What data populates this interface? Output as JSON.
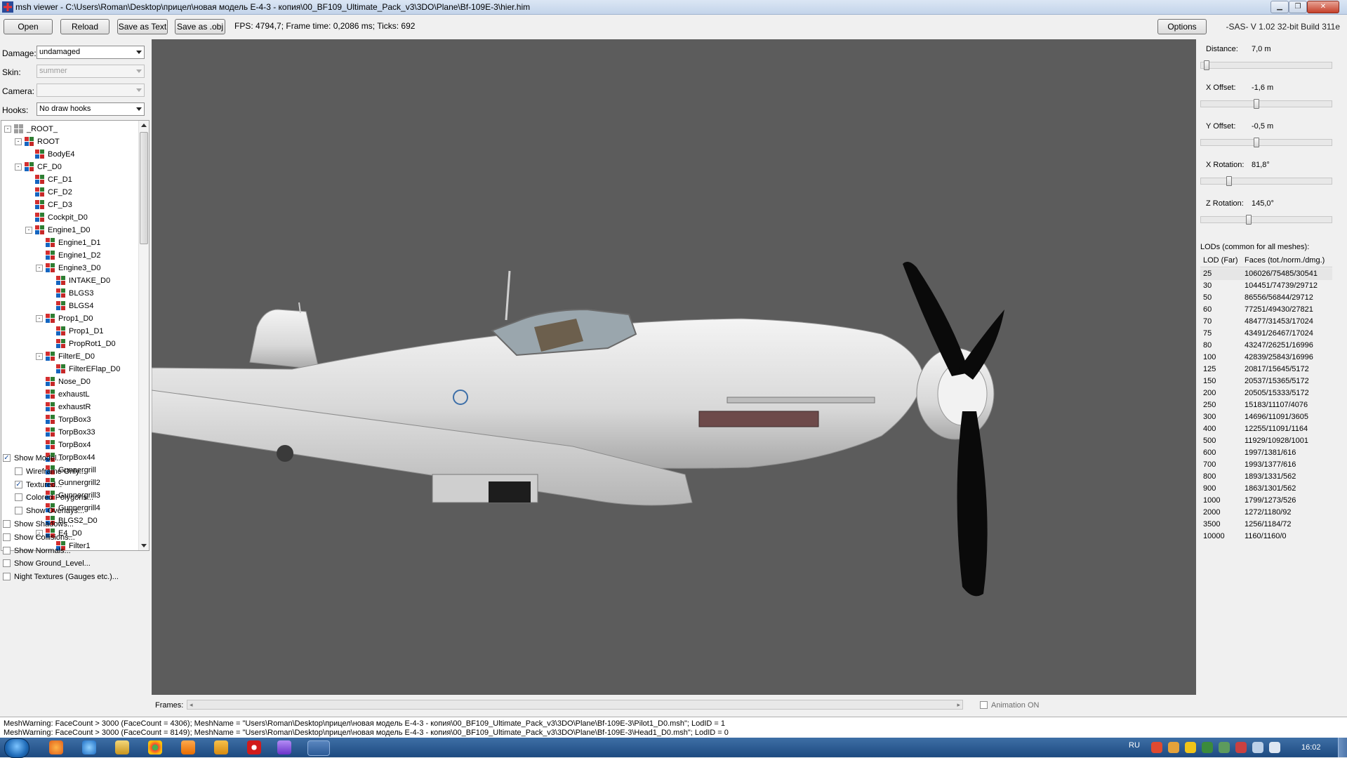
{
  "window": {
    "title": "msh viewer - C:\\Users\\Roman\\Desktop\\прицел\\новая модель E-4-3 - копия\\00_BF109_Ultimate_Pack_v3\\3DO\\Plane\\Bf-109E-3\\hier.him"
  },
  "toolbar": {
    "open": "Open",
    "reload": "Reload",
    "save_text": "Save as Text",
    "save_obj": "Save as .obj",
    "fps": "FPS: 4794,7; Frame time: 0,2086 ms; Ticks: 692",
    "options": "Options",
    "version": "-SAS- V 1.02  32-bit  Build 311e"
  },
  "left": {
    "damage_label": "Damage:",
    "damage_value": "undamaged",
    "skin_label": "Skin:",
    "skin_value": "summer",
    "camera_label": "Camera:",
    "camera_value": "",
    "hooks_label": "Hooks:",
    "hooks_value": "No draw hooks",
    "tree": [
      {
        "label": "_ROOT_",
        "depth": 0,
        "exp": "-"
      },
      {
        "label": "ROOT",
        "depth": 1,
        "exp": "-"
      },
      {
        "label": "BodyE4",
        "depth": 2,
        "exp": ""
      },
      {
        "label": "CF_D0",
        "depth": 1,
        "exp": "-"
      },
      {
        "label": "CF_D1",
        "depth": 2,
        "exp": ""
      },
      {
        "label": "CF_D2",
        "depth": 2,
        "exp": ""
      },
      {
        "label": "CF_D3",
        "depth": 2,
        "exp": ""
      },
      {
        "label": "Cockpit_D0",
        "depth": 2,
        "exp": ""
      },
      {
        "label": "Engine1_D0",
        "depth": 2,
        "exp": "-"
      },
      {
        "label": "Engine1_D1",
        "depth": 3,
        "exp": ""
      },
      {
        "label": "Engine1_D2",
        "depth": 3,
        "exp": ""
      },
      {
        "label": "Engine3_D0",
        "depth": 3,
        "exp": "-"
      },
      {
        "label": "INTAKE_D0",
        "depth": 4,
        "exp": ""
      },
      {
        "label": "BLGS3",
        "depth": 4,
        "exp": ""
      },
      {
        "label": "BLGS4",
        "depth": 4,
        "exp": ""
      },
      {
        "label": "Prop1_D0",
        "depth": 3,
        "exp": "-"
      },
      {
        "label": "Prop1_D1",
        "depth": 4,
        "exp": ""
      },
      {
        "label": "PropRot1_D0",
        "depth": 4,
        "exp": ""
      },
      {
        "label": "FilterE_D0",
        "depth": 3,
        "exp": "-"
      },
      {
        "label": "FilterEFlap_D0",
        "depth": 4,
        "exp": ""
      },
      {
        "label": "Nose_D0",
        "depth": 3,
        "exp": ""
      },
      {
        "label": "exhaustL",
        "depth": 3,
        "exp": ""
      },
      {
        "label": "exhaustR",
        "depth": 3,
        "exp": ""
      },
      {
        "label": "TorpBox3",
        "depth": 3,
        "exp": ""
      },
      {
        "label": "TorpBox33",
        "depth": 3,
        "exp": ""
      },
      {
        "label": "TorpBox4",
        "depth": 3,
        "exp": ""
      },
      {
        "label": "TorpBox44",
        "depth": 3,
        "exp": ""
      },
      {
        "label": "Gunnergrill",
        "depth": 3,
        "exp": ""
      },
      {
        "label": "Gunnergrill2",
        "depth": 3,
        "exp": ""
      },
      {
        "label": "Gunnergrill3",
        "depth": 3,
        "exp": ""
      },
      {
        "label": "Gunnergrill4",
        "depth": 3,
        "exp": ""
      },
      {
        "label": "BLGS2_D0",
        "depth": 3,
        "exp": ""
      },
      {
        "label": "E4_D0",
        "depth": 3,
        "exp": "-"
      },
      {
        "label": "Filter1",
        "depth": 4,
        "exp": ""
      }
    ],
    "checks": [
      {
        "label": "Show Model...",
        "checked": true,
        "indent": 0
      },
      {
        "label": "Wireframe Only...",
        "checked": false,
        "indent": 1
      },
      {
        "label": "Textured...",
        "checked": true,
        "indent": 1
      },
      {
        "label": "Colored Polygons...",
        "checked": false,
        "indent": 1
      },
      {
        "label": "Show Overlays...",
        "checked": false,
        "indent": 1
      },
      {
        "label": "Show Shadows...",
        "checked": false,
        "indent": 0
      },
      {
        "label": "Show Collisions...",
        "checked": false,
        "indent": 0
      },
      {
        "label": "Show Normals...",
        "checked": false,
        "indent": 0
      },
      {
        "label": "Show Ground_Level...",
        "checked": false,
        "indent": 0
      },
      {
        "label": "Night Textures (Gauges etc.)...",
        "checked": false,
        "indent": 0
      }
    ]
  },
  "frames": {
    "label": "Frames:",
    "animation_label": "Animation ON"
  },
  "right": {
    "distance_label": "Distance:",
    "distance_value": "7,0 m",
    "xoffset_label": "X Offset:",
    "xoffset_value": "-1,6 m",
    "yoffset_label": "Y Offset:",
    "yoffset_value": "-0,5 m",
    "xrot_label": "X Rotation:",
    "xrot_value": "81,8°",
    "zrot_label": "Z Rotation:",
    "zrot_value": "145,0°",
    "slider_levels": {
      "distance": 0.02,
      "xoffset": 0.42,
      "yoffset": 0.42,
      "xrot": 0.2,
      "zrot": 0.36
    },
    "lods_title": "LODs (common for all meshes):",
    "lod_header": [
      "LOD (Far)",
      "Faces (tot./norm./dmg.)"
    ],
    "lods": [
      [
        "25",
        "106026/75485/30541"
      ],
      [
        "30",
        "104451/74739/29712"
      ],
      [
        "50",
        "86556/56844/29712"
      ],
      [
        "60",
        "77251/49430/27821"
      ],
      [
        "70",
        "48477/31453/17024"
      ],
      [
        "75",
        "43491/26467/17024"
      ],
      [
        "80",
        "43247/26251/16996"
      ],
      [
        "100",
        "42839/25843/16996"
      ],
      [
        "125",
        "20817/15645/5172"
      ],
      [
        "150",
        "20537/15365/5172"
      ],
      [
        "200",
        "20505/15333/5172"
      ],
      [
        "250",
        "15183/11107/4076"
      ],
      [
        "300",
        "14696/11091/3605"
      ],
      [
        "400",
        "12255/11091/1164"
      ],
      [
        "500",
        "11929/10928/1001"
      ],
      [
        "600",
        "1997/1381/616"
      ],
      [
        "700",
        "1993/1377/616"
      ],
      [
        "800",
        "1893/1331/562"
      ],
      [
        "900",
        "1863/1301/562"
      ],
      [
        "1000",
        "1799/1273/526"
      ],
      [
        "2000",
        "1272/1180/92"
      ],
      [
        "3500",
        "1256/1184/72"
      ],
      [
        "10000",
        "1160/1160/0"
      ]
    ]
  },
  "log": [
    "MeshWarning: FaceCount > 3000 (FaceCount = 4306); MeshName = \"Users\\Roman\\Desktop\\прицел\\новая модель E-4-3 - копия\\00_BF109_Ultimate_Pack_v3\\3DO\\Plane\\Bf-109E-3\\Pilot1_D0.msh\"; LodID = 1",
    "MeshWarning: FaceCount > 3000 (FaceCount = 8149); MeshName = \"Users\\Roman\\Desktop\\прицел\\новая модель E-4-3 - копия\\00_BF109_Ultimate_Pack_v3\\3DO\\Plane\\Bf-109E-3\\Head1_D0.msh\"; LodID = 0"
  ],
  "taskbar": {
    "lang": "RU",
    "clock": "16:02"
  },
  "colors": {
    "viewport_bg": "#5c5c5c",
    "taskbar": "#1d4a80",
    "lod_selected": "#e6e6e6"
  }
}
